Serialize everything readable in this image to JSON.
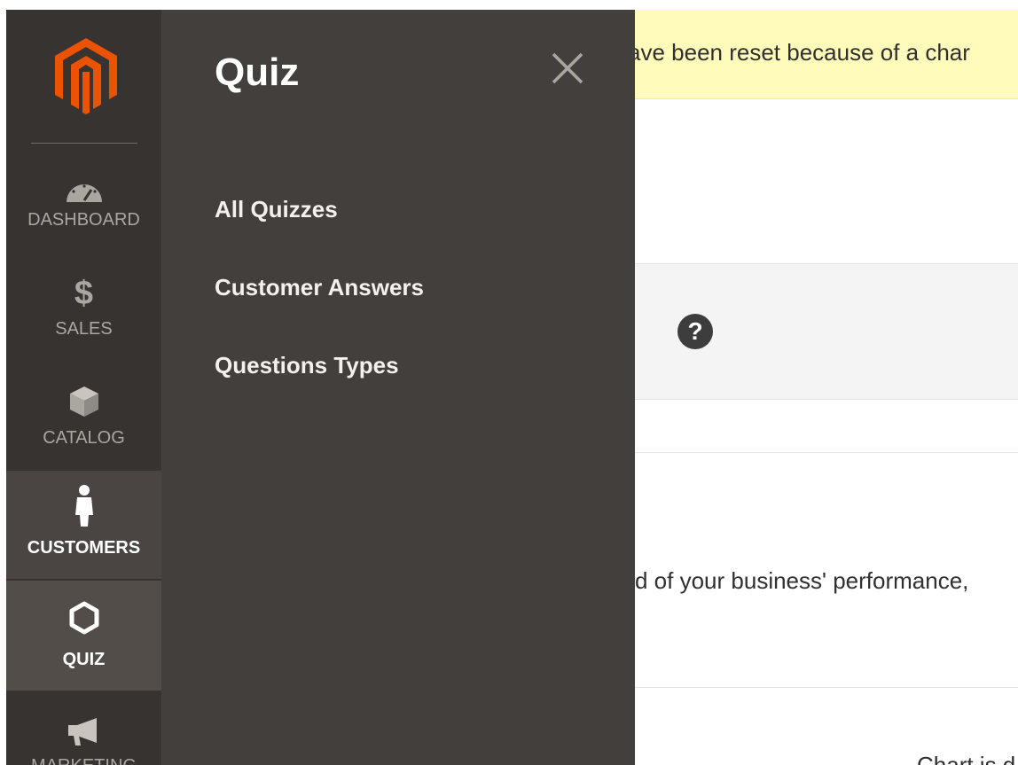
{
  "background": {
    "notice_text": "ave been reset because of a char",
    "performance_text": "d of your business' performance,",
    "chart_text": "Chart is d"
  },
  "sidebar": {
    "logo": "magento-logo",
    "items": [
      {
        "label": "DASHBOARD",
        "icon": "speedometer-icon"
      },
      {
        "label": "SALES",
        "icon": "dollar-icon"
      },
      {
        "label": "CATALOG",
        "icon": "box-icon"
      },
      {
        "label": "CUSTOMERS",
        "icon": "person-icon",
        "state": "hover"
      },
      {
        "label": "QUIZ",
        "icon": "hexagon-icon",
        "state": "active"
      },
      {
        "label": "MARKETING",
        "icon": "megaphone-icon"
      }
    ]
  },
  "flyout": {
    "title": "Quiz",
    "close_icon": "close-icon",
    "links": [
      {
        "label": "All Quizzes"
      },
      {
        "label": "Customer Answers"
      },
      {
        "label": "Questions Types"
      }
    ]
  },
  "colors": {
    "sidebar_bg": "#373330",
    "flyout_bg": "#433f3d",
    "logo_orange": "#eb5202",
    "notice_bg": "#fffbbb"
  }
}
